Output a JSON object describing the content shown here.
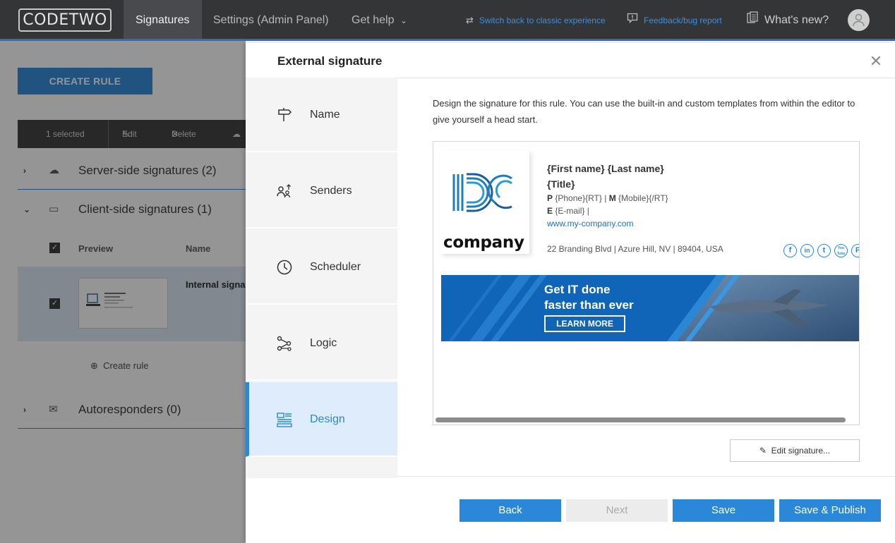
{
  "topbar": {
    "logo": "CODETWO",
    "nav": [
      "Signatures",
      "Settings (Admin Panel)",
      "Get help"
    ],
    "get_help_chevron": "⌄",
    "switch_classic": "Switch back to classic experience",
    "feedback": "Feedback/bug report",
    "whats_new": "What's new?",
    "accent_color": "#2b6cc4"
  },
  "background_page": {
    "create_rule": "CREATE RULE",
    "bulk": {
      "selected": "1 selected",
      "edit": "Edit",
      "delete": "Delete"
    },
    "groups": [
      {
        "label": "Server-side signatures (2)",
        "icon": "cloud-icon",
        "expanded": false
      },
      {
        "label": "Client-side signatures (1)",
        "icon": "monitor-icon",
        "expanded": true
      },
      {
        "label": "Autoresponders (0)",
        "icon": "autoresponder-icon",
        "expanded": false
      }
    ],
    "columns": {
      "preview": "Preview",
      "name": "Name"
    },
    "row": {
      "name": "Internal signa",
      "checked": true
    },
    "create_rule_link": "Create rule"
  },
  "modal": {
    "title": "External signature",
    "steps": [
      {
        "label": "Name",
        "icon": "signpost-icon"
      },
      {
        "label": "Senders",
        "icon": "senders-icon"
      },
      {
        "label": "Scheduler",
        "icon": "clock-icon"
      },
      {
        "label": "Logic",
        "icon": "logic-icon"
      },
      {
        "label": "Design",
        "icon": "design-icon",
        "active": true
      }
    ],
    "description": "Design the signature for this rule. You can use the built-in and custom templates from within the editor to give yourself a head start.",
    "signature": {
      "company": "company",
      "name": "{First name} {Last name}",
      "title": "{Title}",
      "phone_label": "P",
      "phone": "{Phone}{RT}",
      "separator": "|",
      "mobile_label": "M",
      "mobile": "{Mobile}{/RT}",
      "email_label": "E",
      "email": "{E-mail} |",
      "website": "www.my-company.com",
      "address": "22 Branding Blvd | Azure Hill, NV | 89404, USA",
      "social": [
        {
          "icon": "facebook-icon",
          "glyph": "f"
        },
        {
          "icon": "linkedin-icon",
          "glyph": "in"
        },
        {
          "icon": "twitter-icon",
          "glyph": "t"
        },
        {
          "icon": "youtube-icon",
          "glyph": "You Tube"
        },
        {
          "icon": "pinterest-icon",
          "glyph": "P"
        }
      ],
      "banner_line1": "Get IT done",
      "banner_line2": "faster than ever",
      "banner_button": "LEARN MORE"
    },
    "edit_signature": "Edit signature...",
    "buttons": {
      "back": "Back",
      "next": "Next",
      "save": "Save",
      "save_publish": "Save & Publish"
    },
    "accent_color": "#2b88d8"
  }
}
